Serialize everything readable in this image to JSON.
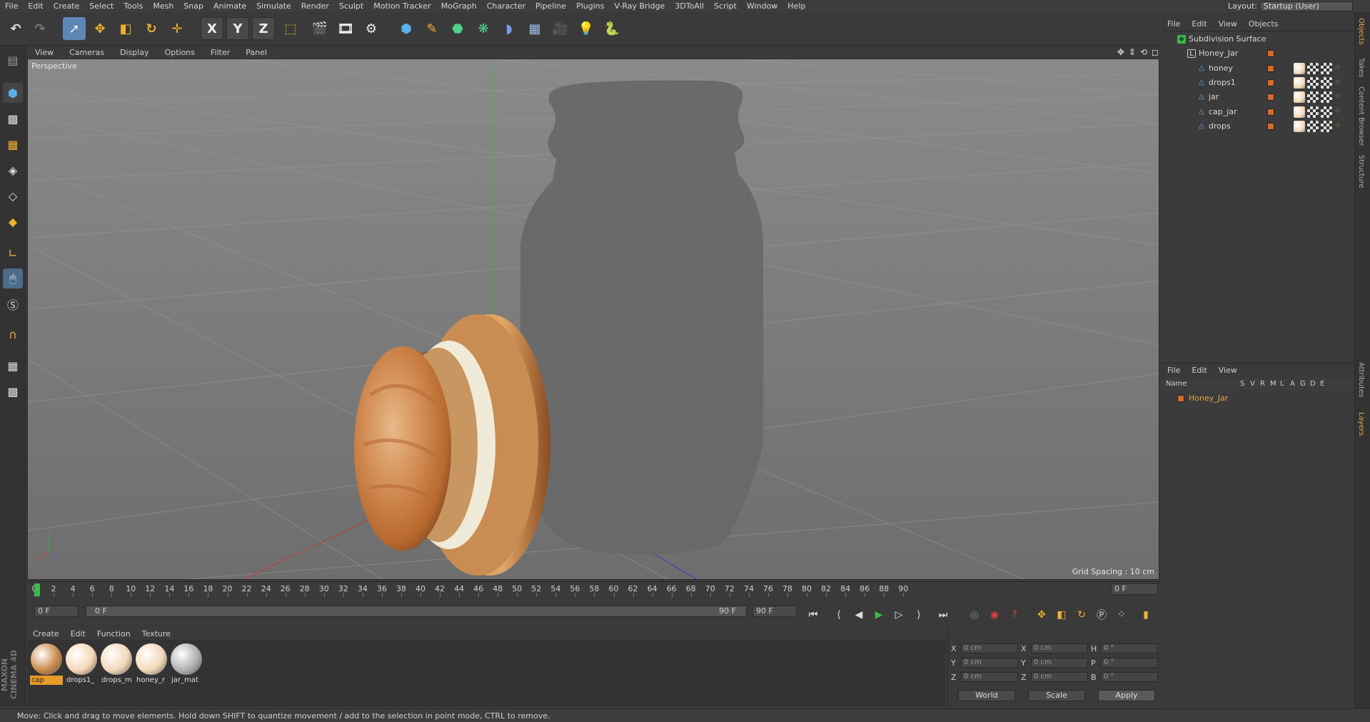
{
  "menu": [
    "File",
    "Edit",
    "Create",
    "Select",
    "Tools",
    "Mesh",
    "Snap",
    "Animate",
    "Simulate",
    "Render",
    "Sculpt",
    "Motion Tracker",
    "MoGraph",
    "Character",
    "Pipeline",
    "Plugins",
    "V-Ray Bridge",
    "3DToAll",
    "Script",
    "Window",
    "Help"
  ],
  "layout": {
    "label": "Layout:",
    "value": "Startup (User)"
  },
  "toolbar": {
    "x_label": "X",
    "y_label": "Y",
    "z_label": "Z"
  },
  "viewport": {
    "menu": [
      "View",
      "Cameras",
      "Display",
      "Options",
      "Filter",
      "Panel"
    ],
    "label": "Perspective",
    "grid_spacing": "Grid Spacing : 10 cm"
  },
  "timeline": {
    "ticks": [
      "0",
      "2",
      "4",
      "6",
      "8",
      "10",
      "12",
      "14",
      "16",
      "18",
      "20",
      "22",
      "24",
      "26",
      "28",
      "30",
      "32",
      "34",
      "36",
      "38",
      "40",
      "42",
      "44",
      "46",
      "48",
      "50",
      "52",
      "54",
      "56",
      "58",
      "60",
      "62",
      "64",
      "66",
      "68",
      "70",
      "72",
      "74",
      "76",
      "78",
      "80",
      "82",
      "84",
      "86",
      "88",
      "90"
    ],
    "current_frame": "0 F"
  },
  "transport": {
    "start_field": "0 F",
    "slider_start": "0 F",
    "slider_end": "90 F",
    "end_field": "90 F"
  },
  "materials": {
    "menu": [
      "Create",
      "Edit",
      "Function",
      "Texture"
    ],
    "items": [
      {
        "name": "cap",
        "color": "#c9894a"
      },
      {
        "name": "drops1_",
        "color": "#f4d8b8"
      },
      {
        "name": "drops_m",
        "color": "#f4d8b8"
      },
      {
        "name": "honey_r",
        "color": "#f4d8b8"
      },
      {
        "name": "jar_mat",
        "color": "#b0b0b0"
      }
    ]
  },
  "coords": {
    "rows": [
      {
        "a": "X",
        "av": "0 cm",
        "b": "X",
        "bv": "0 cm",
        "c": "H",
        "cv": "0 °"
      },
      {
        "a": "Y",
        "av": "0 cm",
        "b": "Y",
        "bv": "0 cm",
        "c": "P",
        "cv": "0 °"
      },
      {
        "a": "Z",
        "av": "0 cm",
        "b": "Z",
        "bv": "0 cm",
        "c": "B",
        "cv": "0 °"
      }
    ],
    "world": "World",
    "scale": "Scale",
    "apply": "Apply"
  },
  "objects": {
    "menu": [
      "File",
      "Edit",
      "View",
      "Objects"
    ],
    "tree": [
      {
        "name": "Subdivision Surface",
        "indent": 0,
        "icon": "subdivision-icon"
      },
      {
        "name": "Honey_Jar",
        "indent": 1,
        "icon": "null-icon"
      },
      {
        "name": "honey",
        "indent": 2,
        "icon": "polygon-icon"
      },
      {
        "name": "drops1",
        "indent": 2,
        "icon": "polygon-icon"
      },
      {
        "name": "jar",
        "indent": 2,
        "icon": "polygon-icon"
      },
      {
        "name": "cap_jar",
        "indent": 2,
        "icon": "polygon-icon"
      },
      {
        "name": "drops",
        "indent": 2,
        "icon": "polygon-icon"
      }
    ]
  },
  "layers": {
    "menu": [
      "File",
      "Edit",
      "View"
    ],
    "header": {
      "name": "Name",
      "cols": [
        "S",
        "V",
        "R",
        "M",
        "L",
        "A",
        "G",
        "D",
        "E"
      ]
    },
    "items": [
      {
        "name": "Honey_Jar",
        "color": "#d9682a"
      }
    ]
  },
  "side_tabs": [
    "Objects",
    "Takes",
    "Content Browser",
    "Structure",
    "Attributes",
    "Layers"
  ],
  "brand": "MAXON CINEMA 4D",
  "status": "Move: Click and drag to move elements. Hold down SHIFT to quantize movement / add to the selection in point mode, CTRL to remove."
}
